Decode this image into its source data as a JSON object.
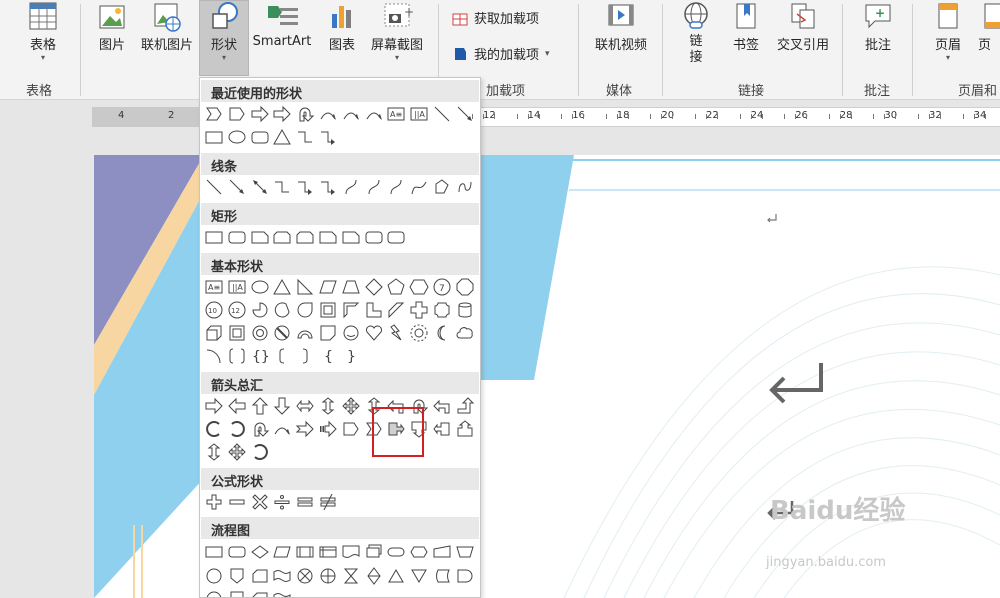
{
  "ribbon": {
    "table": {
      "label": "表格",
      "group": "表格"
    },
    "picture": {
      "label": "图片"
    },
    "online_picture": {
      "label": "联机图片"
    },
    "shapes": {
      "label": "形状"
    },
    "smartart": {
      "label": "SmartArt"
    },
    "chart": {
      "label": "图表"
    },
    "screenshot": {
      "label": "屏幕截图"
    },
    "get_addins": {
      "label": "获取加载项"
    },
    "my_addins": {
      "label": "我的加载项"
    },
    "addins_group": "加载项",
    "online_video": {
      "label": "联机视频"
    },
    "media_group": "媒体",
    "link": {
      "label": "链接"
    },
    "bookmark": {
      "label": "书签"
    },
    "cross_ref": {
      "label": "交叉引用"
    },
    "links_group": "链接",
    "comment": {
      "label": "批注"
    },
    "comments_group": "批注",
    "header": {
      "label": "页眉"
    },
    "footer": {
      "label": "页"
    },
    "header_footer_group": "页眉和"
  },
  "ruler": {
    "left_numbers": [
      "4",
      "2"
    ],
    "right_numbers": [
      "12",
      "14",
      "16",
      "18",
      "20",
      "22",
      "24",
      "26",
      "28",
      "30",
      "32",
      "34"
    ]
  },
  "shapes_menu": {
    "sections": [
      {
        "title": "最近使用的形状"
      },
      {
        "title": "线条"
      },
      {
        "title": "矩形"
      },
      {
        "title": "基本形状"
      },
      {
        "title": "箭头总汇"
      },
      {
        "title": "公式形状"
      },
      {
        "title": "流程图"
      }
    ],
    "highlighted_shape": "callout-right-arrow"
  },
  "watermark": {
    "text": "Baidu经验",
    "sub": "jingyan.baidu.com"
  },
  "colors": {
    "accent": "#8fd0ee",
    "highlight": "#d02020",
    "purple": "#8d8fc2",
    "peach": "#f8d6a2"
  }
}
